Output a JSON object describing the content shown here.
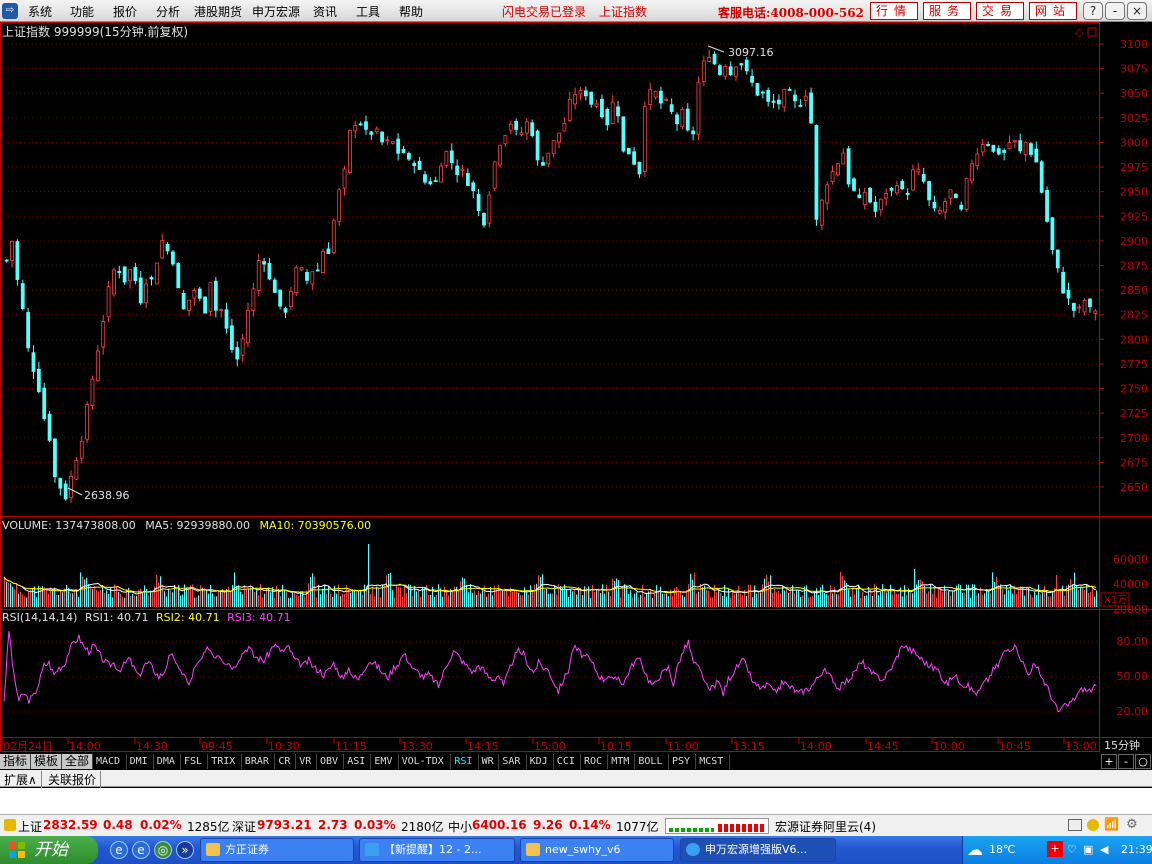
{
  "menubar": {
    "items": [
      "系统",
      "功能",
      "报价",
      "分析",
      "港股期货",
      "申万宏源",
      "资讯",
      "工具",
      "帮助"
    ],
    "notice1": "闪电交易已登录",
    "notice2": "上证指数",
    "hotline": "客服电话:4008-000-562",
    "buttons": [
      "行情",
      "服务",
      "交易",
      "网站"
    ],
    "window_buttons": [
      "?",
      "-",
      "×"
    ]
  },
  "price_panel": {
    "title": "上证指数 999999(15分钟.前复权)",
    "high_label": "3097.16",
    "low_label": "2638.96",
    "y_ticks": [
      "3100",
      "3075",
      "3050",
      "3025",
      "3000",
      "2975",
      "2950",
      "2925",
      "2900",
      "2875",
      "2850",
      "2825",
      "2800",
      "2775",
      "2750",
      "2725",
      "2700",
      "2675",
      "2650"
    ]
  },
  "volume_panel": {
    "label_volume": "VOLUME: 137473808.00",
    "label_ma5": "MA5: 92939880.00",
    "label_ma10": "MA10: 70390576.00",
    "y_ticks": [
      "60000",
      "40000",
      "20000"
    ],
    "unit": "X1万"
  },
  "rsi_panel": {
    "label_main": "RSI(14,14,14)",
    "label_rsi1": "RSI1: 40.71",
    "label_rsi2": "RSI2: 40.71",
    "label_rsi3": "RSI3: 40.71",
    "y_ticks": [
      "80.00",
      "50.00",
      "20.00"
    ]
  },
  "time_axis": {
    "labels": [
      "02月24日",
      "14:00",
      "14:30",
      "09:45",
      "10:30",
      "11:15",
      "13:30",
      "14:15",
      "15:00",
      "10:15",
      "11:00",
      "13:15",
      "14:00",
      "14:45",
      "10:00",
      "10:45",
      "13:00"
    ],
    "period": "15分钟"
  },
  "indicator_tabs": [
    "指标",
    "模板",
    "全部",
    "MACD",
    "DMI",
    "DMA",
    "FSL",
    "TRIX",
    "BRAR",
    "CR",
    "VR",
    "OBV",
    "ASI",
    "EMV",
    "VOL-TDX",
    "RSI",
    "WR",
    "SAR",
    "KDJ",
    "CCI",
    "ROC",
    "MTM",
    "BOLL",
    "PSY",
    "MCST"
  ],
  "active_tab": "RSI",
  "scroll_buttons": [
    "+",
    "-",
    "○"
  ],
  "extend_row": [
    "扩展∧",
    "关联报价"
  ],
  "status": {
    "sh_label": "上证",
    "sh_value": "2832.59",
    "sh_change": "0.48",
    "sh_pct": "0.02%",
    "sh_amount": "1285亿",
    "sz_label": "深证",
    "sz_value": "9793.21",
    "sz_change": "2.73",
    "sz_pct": "0.03%",
    "sz_amount": "2180亿",
    "zx_label": "中小",
    "zx_value": "6400.16",
    "zx_change": "9.26",
    "zx_pct": "0.14%",
    "zx_amount": "1077亿",
    "server": "宏源证券阿里云(4)"
  },
  "taskbar": {
    "start": "开始",
    "tasks": [
      "方正证券",
      "【新提醒】12 - 2...",
      "new_swhy_v6",
      "申万宏源增强版V6..."
    ],
    "temp": "18℃",
    "time": "21:39"
  },
  "colors": {
    "up": "#ff4040",
    "down": "#54ffff",
    "ma5": "#ffffff",
    "ma10": "#ffff00",
    "rsi": "#ff40ff",
    "axis": "#c00000",
    "menu_red": "#d00000"
  },
  "chart_data": {
    "type": "candlestick",
    "period": "15min",
    "ylim": [
      2630,
      3110
    ],
    "high_value": 3097.16,
    "low_value": 2638.96,
    "close_series": [
      2880,
      2900,
      2860,
      2830,
      2790,
      2770,
      2750,
      2720,
      2700,
      2660,
      2650,
      2640,
      2660,
      2680,
      2700,
      2730,
      2760,
      2790,
      2820,
      2850,
      2870,
      2870,
      2860,
      2870,
      2860,
      2840,
      2860,
      2860,
      2880,
      2900,
      2890,
      2880,
      2850,
      2830,
      2840,
      2850,
      2840,
      2830,
      2860,
      2830,
      2830,
      2810,
      2790,
      2780,
      2800,
      2830,
      2850,
      2880,
      2880,
      2860,
      2850,
      2830,
      2830,
      2850,
      2870,
      2870,
      2860,
      2870,
      2870,
      2890,
      2890,
      2920,
      2950,
      2970,
      3010,
      3020,
      3020,
      3010,
      3010,
      3010,
      3000,
      3000,
      3000,
      2990,
      2990,
      2980,
      2980,
      2970,
      2960,
      2960,
      2960,
      2980,
      2990,
      2980,
      2970,
      2970,
      2960,
      2950,
      2930,
      2920,
      2950,
      2980,
      3000,
      3010,
      3020,
      3010,
      3010,
      3020,
      3010,
      2980,
      2980,
      2990,
      3000,
      3010,
      3020,
      3040,
      3050,
      3050,
      3050,
      3040,
      3040,
      3030,
      3020,
      3040,
      3030,
      2990,
      2990,
      2980,
      2970,
      3040,
      3050,
      3050,
      3040,
      3040,
      3030,
      3020,
      3030,
      3010,
      3010,
      3060,
      3080,
      3090,
      3080,
      3070,
      3080,
      3070,
      3080,
      3080,
      3070,
      3060,
      3050,
      3050,
      3040,
      3040,
      3040,
      3050,
      3050,
      3040,
      3040,
      3050,
      3020,
      2920,
      2940,
      2960,
      2970,
      2980,
      2990,
      2960,
      2950,
      2940,
      2950,
      2940,
      2930,
      2940,
      2950,
      2950,
      2960,
      2950,
      2950,
      2970,
      2970,
      2960,
      2940,
      2930,
      2930,
      2940,
      2950,
      2940,
      2930,
      2960,
      2980,
      2990,
      3000,
      3000,
      2990,
      2990,
      2990,
      3000,
      3000,
      2990,
      3000,
      2990,
      2980,
      2950,
      2920,
      2890,
      2870,
      2850,
      2840,
      2830,
      2830,
      2840,
      2830,
      2830
    ],
    "volume_max": 65000,
    "rsi_series": [
      30,
      90,
      50,
      30,
      36,
      30,
      34,
      45,
      60,
      62,
      52,
      58,
      60,
      72,
      80,
      84,
      76,
      72,
      77,
      70,
      64,
      60,
      62,
      56,
      60,
      66,
      58,
      50,
      60,
      62,
      56,
      50,
      54,
      66,
      68,
      55,
      54,
      42,
      56,
      62,
      68,
      76,
      68,
      70,
      64,
      62,
      58,
      66,
      72,
      76,
      68,
      66,
      64,
      70,
      78,
      74,
      72,
      76,
      66,
      62,
      60,
      64,
      58,
      56,
      52,
      56,
      62,
      54,
      48,
      58,
      50,
      48,
      56,
      64,
      62,
      58,
      52,
      50,
      58,
      62,
      70,
      64,
      56,
      54,
      50,
      52,
      48,
      42,
      54,
      64,
      72,
      68,
      62,
      58,
      54,
      60,
      56,
      50,
      48,
      52,
      42,
      54,
      66,
      72,
      70,
      60,
      54,
      62,
      58,
      56,
      46,
      38,
      48,
      56,
      76,
      72,
      68,
      66,
      60,
      52,
      48,
      52,
      46,
      50,
      44,
      54,
      62,
      66,
      58,
      48,
      42,
      50,
      54,
      58,
      44,
      62,
      72,
      80,
      62,
      58,
      50,
      38,
      42,
      46,
      36,
      48,
      54,
      60,
      64,
      56,
      44,
      42,
      40,
      44,
      36,
      40,
      46,
      42,
      40,
      36,
      38,
      40,
      44,
      50,
      56,
      52,
      48,
      40,
      44,
      48,
      52,
      60,
      62,
      56,
      52,
      50,
      48,
      54,
      60,
      70,
      78,
      74,
      72,
      68,
      64,
      60,
      58,
      56,
      48,
      44,
      52,
      48,
      44,
      42,
      38,
      36,
      44,
      48,
      56,
      60,
      70,
      74,
      76,
      72,
      62,
      52,
      60,
      56,
      48,
      40,
      30,
      20,
      24,
      26,
      30,
      36,
      40,
      38,
      40,
      42
    ],
    "x_ticks": [
      "02月24日",
      "14:00",
      "14:30",
      "09:45",
      "10:30",
      "11:15",
      "13:30",
      "14:15",
      "15:00",
      "10:15",
      "11:00",
      "13:15",
      "14:00",
      "14:45",
      "10:00",
      "10:45",
      "13:00"
    ]
  }
}
